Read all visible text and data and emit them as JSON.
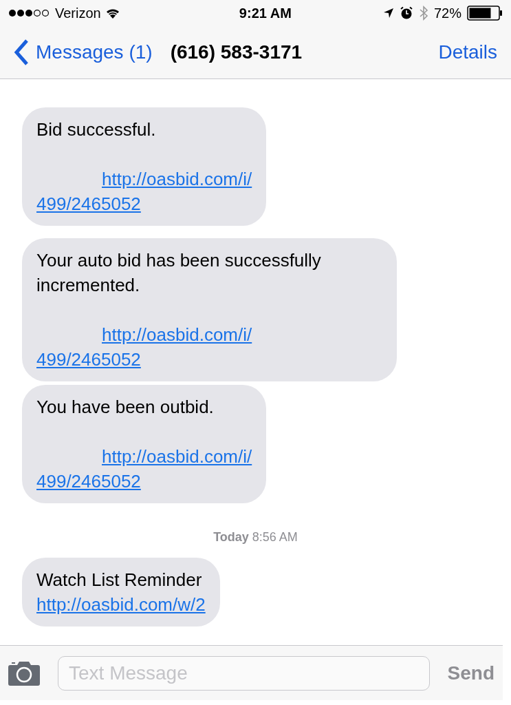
{
  "status_bar": {
    "carrier": "Verizon",
    "time": "9:21 AM",
    "battery": "72%"
  },
  "nav": {
    "back": "Messages (1)",
    "title": "(616) 583-3171",
    "action": "Details"
  },
  "messages": [
    {
      "kind": "incoming",
      "lines": [
        "Bid successful."
      ],
      "link_lines": [
        "http://oasbid.com/i/",
        "499/2465052"
      ]
    },
    {
      "kind": "incoming",
      "lines": [
        "Your auto bid has been successfully incremented."
      ],
      "link_lines": [
        "http://oasbid.com/i/",
        "499/2465052"
      ]
    },
    {
      "kind": "incoming",
      "lines": [
        "You have been outbid."
      ],
      "link_lines": [
        "http://oasbid.com/i/",
        "499/2465052"
      ]
    },
    {
      "kind": "timestamp",
      "day": "Today",
      "time": "8:56 AM"
    },
    {
      "kind": "incoming_compact",
      "lines": [
        "Watch List Reminder"
      ],
      "link_lines": [
        "http://oasbid.com/w/2"
      ]
    }
  ],
  "composer": {
    "placeholder": "Text Message",
    "send": "Send"
  }
}
